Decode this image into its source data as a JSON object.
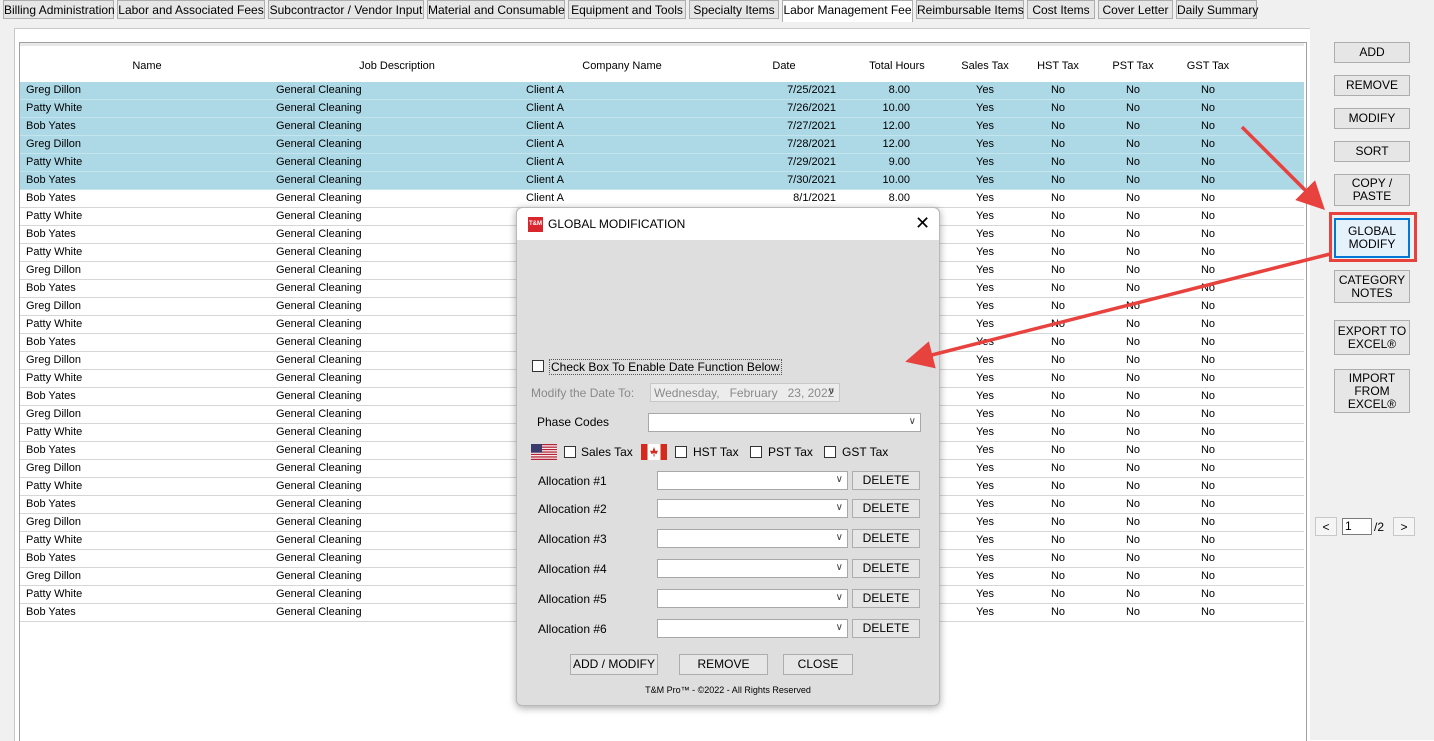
{
  "tabs": [
    {
      "label": "Billing Administration",
      "active": false
    },
    {
      "label": "Labor and Associated Fees",
      "active": false
    },
    {
      "label": "Subcontractor / Vendor Input",
      "active": false
    },
    {
      "label": "Material and Consumable",
      "active": false
    },
    {
      "label": "Equipment and Tools",
      "active": false
    },
    {
      "label": "Specialty Items",
      "active": false
    },
    {
      "label": "Labor Management Fee",
      "active": true
    },
    {
      "label": "Reimbursable Items",
      "active": false
    },
    {
      "label": "Cost Items",
      "active": false
    },
    {
      "label": "Cover Letter",
      "active": false
    },
    {
      "label": "Daily Summary",
      "active": false
    }
  ],
  "grid": {
    "columns": [
      "Name",
      "Job Description",
      "Company Name",
      "Date",
      "Total Hours",
      "Sales Tax",
      "HST Tax",
      "PST Tax",
      "GST Tax"
    ],
    "rows": [
      {
        "name": "Greg Dillon",
        "job": "General Cleaning",
        "company": "Client A",
        "date": "7/25/2021",
        "hours": "8.00",
        "sales": "Yes",
        "hst": "No",
        "pst": "No",
        "gst": "No",
        "selected": true
      },
      {
        "name": "Patty White",
        "job": "General Cleaning",
        "company": "Client A",
        "date": "7/26/2021",
        "hours": "10.00",
        "sales": "Yes",
        "hst": "No",
        "pst": "No",
        "gst": "No",
        "selected": true
      },
      {
        "name": "Bob Yates",
        "job": "General Cleaning",
        "company": "Client A",
        "date": "7/27/2021",
        "hours": "12.00",
        "sales": "Yes",
        "hst": "No",
        "pst": "No",
        "gst": "No",
        "selected": true
      },
      {
        "name": "Greg Dillon",
        "job": "General Cleaning",
        "company": "Client A",
        "date": "7/28/2021",
        "hours": "12.00",
        "sales": "Yes",
        "hst": "No",
        "pst": "No",
        "gst": "No",
        "selected": true
      },
      {
        "name": "Patty White",
        "job": "General Cleaning",
        "company": "Client A",
        "date": "7/29/2021",
        "hours": "9.00",
        "sales": "Yes",
        "hst": "No",
        "pst": "No",
        "gst": "No",
        "selected": true
      },
      {
        "name": "Bob Yates",
        "job": "General Cleaning",
        "company": "Client A",
        "date": "7/30/2021",
        "hours": "10.00",
        "sales": "Yes",
        "hst": "No",
        "pst": "No",
        "gst": "No",
        "selected": true
      },
      {
        "name": "Bob Yates",
        "job": "General Cleaning",
        "company": "Client A",
        "date": "8/1/2021",
        "hours": "8.00",
        "sales": "Yes",
        "hst": "No",
        "pst": "No",
        "gst": "No",
        "selected": false
      },
      {
        "name": "Patty White",
        "job": "General Cleaning",
        "company": "",
        "date": "",
        "hours": "",
        "sales": "Yes",
        "hst": "No",
        "pst": "No",
        "gst": "No",
        "selected": false
      },
      {
        "name": "Bob Yates",
        "job": "General Cleaning",
        "company": "",
        "date": "",
        "hours": "",
        "sales": "Yes",
        "hst": "No",
        "pst": "No",
        "gst": "No",
        "selected": false
      },
      {
        "name": "Patty White",
        "job": "General Cleaning",
        "company": "",
        "date": "",
        "hours": "",
        "sales": "Yes",
        "hst": "No",
        "pst": "No",
        "gst": "No",
        "selected": false
      },
      {
        "name": "Greg Dillon",
        "job": "General Cleaning",
        "company": "",
        "date": "",
        "hours": "",
        "sales": "Yes",
        "hst": "No",
        "pst": "No",
        "gst": "No",
        "selected": false
      },
      {
        "name": "Bob Yates",
        "job": "General Cleaning",
        "company": "",
        "date": "",
        "hours": "",
        "sales": "Yes",
        "hst": "No",
        "pst": "No",
        "gst": "No",
        "selected": false
      },
      {
        "name": "Greg Dillon",
        "job": "General Cleaning",
        "company": "",
        "date": "",
        "hours": "",
        "sales": "Yes",
        "hst": "No",
        "pst": "No",
        "gst": "No",
        "selected": false
      },
      {
        "name": "Patty White",
        "job": "General Cleaning",
        "company": "",
        "date": "",
        "hours": "",
        "sales": "Yes",
        "hst": "No",
        "pst": "No",
        "gst": "No",
        "selected": false
      },
      {
        "name": "Bob Yates",
        "job": "General Cleaning",
        "company": "",
        "date": "",
        "hours": "",
        "sales": "Yes",
        "hst": "No",
        "pst": "No",
        "gst": "No",
        "selected": false
      },
      {
        "name": "Greg Dillon",
        "job": "General Cleaning",
        "company": "",
        "date": "",
        "hours": "",
        "sales": "Yes",
        "hst": "No",
        "pst": "No",
        "gst": "No",
        "selected": false
      },
      {
        "name": "Patty White",
        "job": "General Cleaning",
        "company": "",
        "date": "",
        "hours": "",
        "sales": "Yes",
        "hst": "No",
        "pst": "No",
        "gst": "No",
        "selected": false
      },
      {
        "name": "Bob Yates",
        "job": "General Cleaning",
        "company": "",
        "date": "",
        "hours": "",
        "sales": "Yes",
        "hst": "No",
        "pst": "No",
        "gst": "No",
        "selected": false
      },
      {
        "name": "Greg Dillon",
        "job": "General Cleaning",
        "company": "",
        "date": "",
        "hours": "",
        "sales": "Yes",
        "hst": "No",
        "pst": "No",
        "gst": "No",
        "selected": false
      },
      {
        "name": "Patty White",
        "job": "General Cleaning",
        "company": "",
        "date": "",
        "hours": "",
        "sales": "Yes",
        "hst": "No",
        "pst": "No",
        "gst": "No",
        "selected": false
      },
      {
        "name": "Bob Yates",
        "job": "General Cleaning",
        "company": "",
        "date": "",
        "hours": "",
        "sales": "Yes",
        "hst": "No",
        "pst": "No",
        "gst": "No",
        "selected": false
      },
      {
        "name": "Greg Dillon",
        "job": "General Cleaning",
        "company": "",
        "date": "",
        "hours": "",
        "sales": "Yes",
        "hst": "No",
        "pst": "No",
        "gst": "No",
        "selected": false
      },
      {
        "name": "Patty White",
        "job": "General Cleaning",
        "company": "",
        "date": "",
        "hours": "",
        "sales": "Yes",
        "hst": "No",
        "pst": "No",
        "gst": "No",
        "selected": false
      },
      {
        "name": "Bob Yates",
        "job": "General Cleaning",
        "company": "",
        "date": "",
        "hours": "",
        "sales": "Yes",
        "hst": "No",
        "pst": "No",
        "gst": "No",
        "selected": false
      },
      {
        "name": "Greg Dillon",
        "job": "General Cleaning",
        "company": "",
        "date": "",
        "hours": "",
        "sales": "Yes",
        "hst": "No",
        "pst": "No",
        "gst": "No",
        "selected": false
      },
      {
        "name": "Patty White",
        "job": "General Cleaning",
        "company": "",
        "date": "",
        "hours": "",
        "sales": "Yes",
        "hst": "No",
        "pst": "No",
        "gst": "No",
        "selected": false
      },
      {
        "name": "Bob Yates",
        "job": "General Cleaning",
        "company": "",
        "date": "",
        "hours": "",
        "sales": "Yes",
        "hst": "No",
        "pst": "No",
        "gst": "No",
        "selected": false
      },
      {
        "name": "Greg Dillon",
        "job": "General Cleaning",
        "company": "",
        "date": "",
        "hours": "",
        "sales": "Yes",
        "hst": "No",
        "pst": "No",
        "gst": "No",
        "selected": false
      },
      {
        "name": "Patty White",
        "job": "General Cleaning",
        "company": "",
        "date": "",
        "hours": "",
        "sales": "Yes",
        "hst": "No",
        "pst": "No",
        "gst": "No",
        "selected": false
      },
      {
        "name": "Bob Yates",
        "job": "General Cleaning",
        "company": "",
        "date": "",
        "hours": "",
        "sales": "Yes",
        "hst": "No",
        "pst": "No",
        "gst": "No",
        "selected": false
      }
    ]
  },
  "sidebar": {
    "buttons": [
      {
        "label": "ADD",
        "name": "add-button"
      },
      {
        "label": "REMOVE",
        "name": "remove-button"
      },
      {
        "label": "MODIFY",
        "name": "modify-button"
      },
      {
        "label": "SORT",
        "name": "sort-button"
      },
      {
        "label": "COPY /\nPASTE",
        "name": "copy-paste-button"
      },
      {
        "label": "GLOBAL\nMODIFY",
        "name": "global-modify-button"
      },
      {
        "label": "CATEGORY\nNOTES",
        "name": "category-notes-button"
      },
      {
        "label": "EXPORT TO\nEXCEL®",
        "name": "export-excel-button"
      },
      {
        "label": "IMPORT\nFROM\nEXCEL®",
        "name": "import-excel-button"
      }
    ],
    "pager": {
      "prev": "<",
      "next": ">",
      "current": "1",
      "total": "/2"
    }
  },
  "dialog": {
    "title": "GLOBAL MODIFICATION",
    "logo_text": "T&M",
    "close_symbol": "✕",
    "enable_date_label": "Check Box To Enable Date Function Below",
    "modify_date_label": "Modify the Date To:",
    "date_value": "Wednesday,   February   23, 2022",
    "phase_codes_label": "Phase Codes",
    "sales_tax_label": "Sales Tax",
    "hst_tax_label": "HST Tax",
    "pst_tax_label": "PST Tax",
    "gst_tax_label": "GST Tax",
    "allocations": [
      {
        "label": "Allocation #1",
        "delete": "DELETE"
      },
      {
        "label": "Allocation #2",
        "delete": "DELETE"
      },
      {
        "label": "Allocation #3",
        "delete": "DELETE"
      },
      {
        "label": "Allocation #4",
        "delete": "DELETE"
      },
      {
        "label": "Allocation #5",
        "delete": "DELETE"
      },
      {
        "label": "Allocation #6",
        "delete": "DELETE"
      }
    ],
    "add_modify_label": "ADD / MODIFY",
    "remove_label": "REMOVE",
    "close_label": "CLOSE",
    "footer": "T&M Pro™ - ©2022 - All Rights Reserved"
  },
  "colors": {
    "selected_row": "#add8e6",
    "highlight_red": "#e8423f",
    "focus_blue": "#0078d7"
  }
}
